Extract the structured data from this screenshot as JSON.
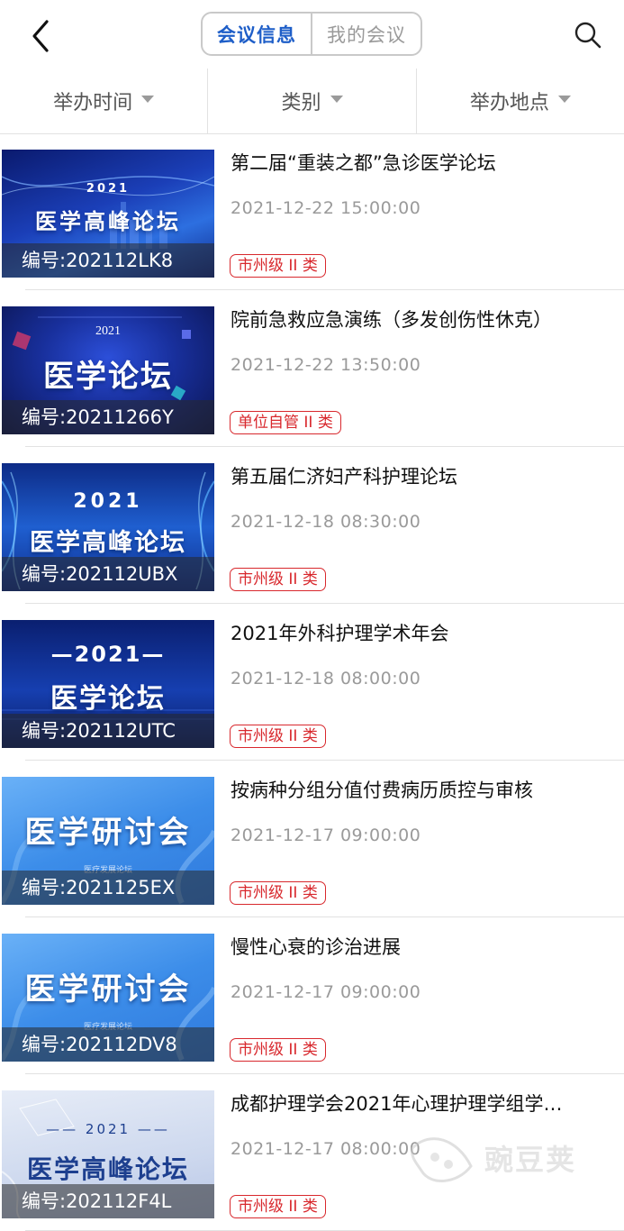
{
  "header": {
    "tabs": [
      {
        "label": "会议信息",
        "active": true
      },
      {
        "label": "我的会议",
        "active": false
      }
    ]
  },
  "filters": [
    {
      "label": "举办时间"
    },
    {
      "label": "类别"
    },
    {
      "label": "举办地点"
    }
  ],
  "meetings": [
    {
      "thumb_year": "2021",
      "thumb_title": "医学高峰论坛",
      "code": "编号:202112LK8",
      "title": "第二届“重装之都”急诊医学论坛",
      "time": "2021-12-22 15:00:00",
      "tag": "市州级 II 类"
    },
    {
      "thumb_year": "2021",
      "thumb_title": "医学论坛",
      "code": "编号:20211266Y",
      "title": "院前急救应急演练（多发创伤性休克）",
      "time": "2021-12-22 13:50:00",
      "tag": "单位自管 II 类"
    },
    {
      "thumb_year": "2021",
      "thumb_title": "医学高峰论坛",
      "code": "编号:202112UBX",
      "title": "第五届仁济妇产科护理论坛",
      "time": "2021-12-18 08:30:00",
      "tag": "市州级 II 类"
    },
    {
      "thumb_year": "—2021—",
      "thumb_title": "医学论坛",
      "code": "编号:202112UTC",
      "title": "2021年外科护理学术年会",
      "time": "2021-12-18 08:00:00",
      "tag": "市州级 II 类"
    },
    {
      "thumb_year": "",
      "thumb_title": "医学研讨会",
      "thumb_sub": "医疗发展论坛",
      "code": "编号:2021125EX",
      "title": "按病种分组分值付费病历质控与审核",
      "time": "2021-12-17 09:00:00",
      "tag": "市州级 II 类"
    },
    {
      "thumb_year": "",
      "thumb_title": "医学研讨会",
      "thumb_sub": "医疗发展论坛",
      "code": "编号:202112DV8",
      "title": "慢性心衰的诊治进展",
      "time": "2021-12-17 09:00:00",
      "tag": "市州级 II 类"
    },
    {
      "thumb_year": "—— 2021 ——",
      "thumb_title": "医学高峰论坛",
      "code": "编号:202112F4L",
      "title": "成都护理学会2021年心理护理学组学…",
      "time": "2021-12-17 08:00:00",
      "tag": "市州级 II 类"
    }
  ],
  "watermark": {
    "text": "豌豆荚"
  },
  "colors": {
    "accent": "#1e5ec8",
    "tag": "#d8282d",
    "muted": "#9a9a9a"
  }
}
